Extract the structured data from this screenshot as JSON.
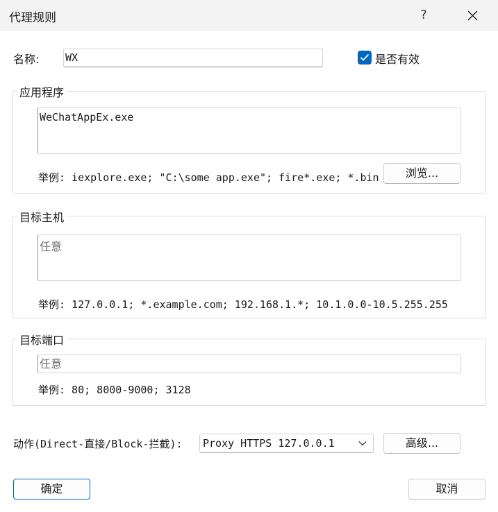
{
  "window": {
    "title": "代理规则",
    "help_label": "?"
  },
  "name": {
    "label": "名称:",
    "value": "WX",
    "enabled_label": "是否有效",
    "enabled": true
  },
  "applications": {
    "group_title": "应用程序",
    "value": "WeChatAppEx.exe",
    "example": "举例: iexplore.exe; \"C:\\some app.exe\"; fire*.exe; *.bin",
    "browse_label": "浏览..."
  },
  "target_hosts": {
    "group_title": "目标主机",
    "placeholder": "任意",
    "example": "举例: 127.0.0.1; *.example.com; 192.168.1.*; 10.1.0.0-10.5.255.255"
  },
  "target_ports": {
    "group_title": "目标端口",
    "placeholder": "任意",
    "example": "举例: 80; 8000-9000; 3128"
  },
  "action": {
    "label": "动作(Direct-直接/Block-拦截):",
    "selected": "Proxy HTTPS 127.0.0.1",
    "advanced_label": "高级..."
  },
  "footer": {
    "ok_label": "确定",
    "cancel_label": "取消"
  },
  "colors": {
    "accent": "#0067c0",
    "titlebar": "#f3f3f3"
  }
}
